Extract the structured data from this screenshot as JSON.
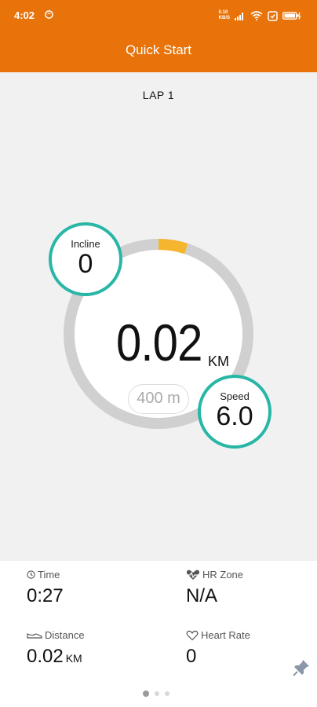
{
  "status_bar": {
    "time": "4:02",
    "net_speed_top": "0.10",
    "net_speed_bottom": "KB/S"
  },
  "app_bar": {
    "title": "Quick Start"
  },
  "workout": {
    "lap_label": "LAP 1",
    "distance_value": "0.02",
    "distance_unit": "KM",
    "lap_length": "400 m",
    "lap_progress_fraction": 0.05,
    "incline": {
      "label": "Incline",
      "value": "0"
    },
    "speed": {
      "label": "Speed",
      "value": "6.0"
    }
  },
  "stats": {
    "time": {
      "label": "Time",
      "value": "0:27",
      "icon": "clock-icon"
    },
    "hr_zone": {
      "label": "HR Zone",
      "value": "N/A",
      "icon": "heart-pulse-icon"
    },
    "distance": {
      "label": "Distance",
      "value": "0.02",
      "unit": "KM",
      "icon": "shoe-icon"
    },
    "heart_rate": {
      "label": "Heart Rate",
      "value": "0",
      "icon": "heart-outline-icon"
    }
  },
  "pager": {
    "page_count": 3,
    "active_index": 0
  },
  "colors": {
    "brand": "#e8730a",
    "accent_teal": "#28b6a6",
    "progress": "#f5b52e",
    "track": "#d0d0d0"
  }
}
